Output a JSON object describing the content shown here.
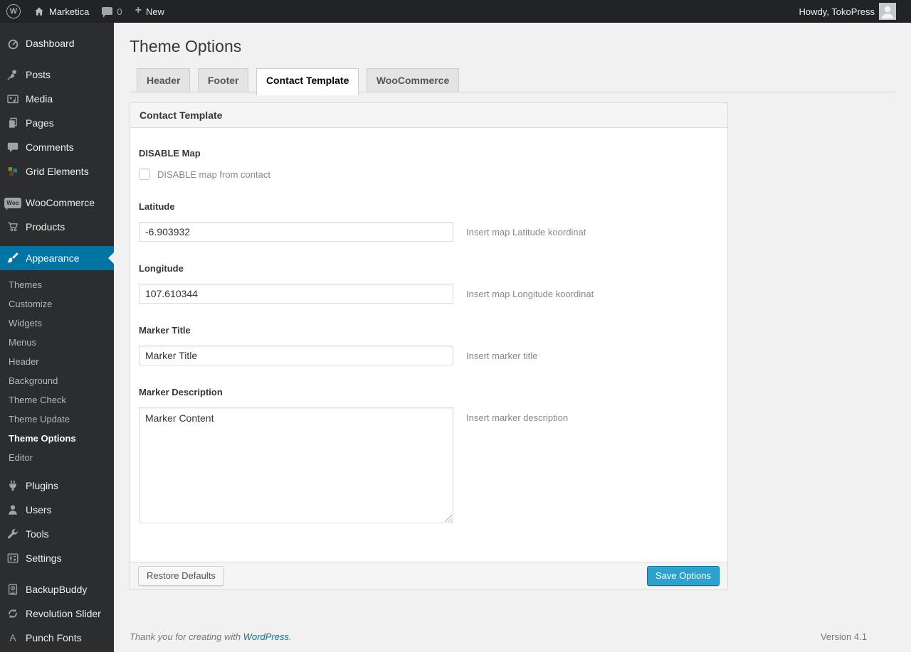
{
  "admin_bar": {
    "site_name": "Marketica",
    "comment_count": "0",
    "new_label": "New",
    "howdy_text": "Howdy, TokoPress"
  },
  "icons": {
    "wp_logo_glyph": "W",
    "plus_glyph": "+",
    "woo_badge_text": "Woo",
    "punch_fonts_glyph": "A"
  },
  "sidebar": {
    "items": [
      {
        "label": "Dashboard"
      },
      {
        "label": "Posts"
      },
      {
        "label": "Media"
      },
      {
        "label": "Pages"
      },
      {
        "label": "Comments"
      },
      {
        "label": "Grid Elements"
      },
      {
        "label": "WooCommerce"
      },
      {
        "label": "Products"
      },
      {
        "label": "Appearance",
        "active": true
      },
      {
        "label": "Plugins"
      },
      {
        "label": "Users"
      },
      {
        "label": "Tools"
      },
      {
        "label": "Settings"
      },
      {
        "label": "BackupBuddy"
      },
      {
        "label": "Revolution Slider"
      },
      {
        "label": "Punch Fonts"
      }
    ],
    "appearance_submenu": [
      {
        "label": "Themes"
      },
      {
        "label": "Customize"
      },
      {
        "label": "Widgets"
      },
      {
        "label": "Menus"
      },
      {
        "label": "Header"
      },
      {
        "label": "Background"
      },
      {
        "label": "Theme Check"
      },
      {
        "label": "Theme Update"
      },
      {
        "label": "Theme Options",
        "active": true
      },
      {
        "label": "Editor"
      }
    ]
  },
  "page": {
    "title": "Theme Options",
    "tabs": [
      {
        "label": "Header"
      },
      {
        "label": "Footer"
      },
      {
        "label": "Contact Template",
        "active": true
      },
      {
        "label": "WooCommerce"
      }
    ],
    "panel": {
      "title": "Contact Template",
      "disable_map": {
        "label": "DISABLE Map",
        "checkbox_label": "DISABLE map from contact",
        "checked": false
      },
      "latitude": {
        "label": "Latitude",
        "value": "-6.903932",
        "description": "Insert map Latitude koordinat"
      },
      "longitude": {
        "label": "Longitude",
        "value": "107.610344",
        "description": "Insert map Longitude koordinat"
      },
      "marker_title": {
        "label": "Marker Title",
        "value": "Marker Title",
        "description": "Insert marker title"
      },
      "marker_description": {
        "label": "Marker Description",
        "value": "Marker Content",
        "description": "Insert marker description"
      },
      "restore_button": "Restore Defaults",
      "save_button": "Save Options"
    }
  },
  "footer": {
    "thanks_text": "Thank you for creating with",
    "link_label": "WordPress",
    "period": ".",
    "version": "Version 4.1"
  },
  "colors": {
    "menu_highlight": "#0074a2",
    "primary_button": "#2ea2cc",
    "admin_bar_bg": "#222326",
    "sidebar_bg": "#2b2d2f",
    "content_bg": "#f1f1f1"
  }
}
